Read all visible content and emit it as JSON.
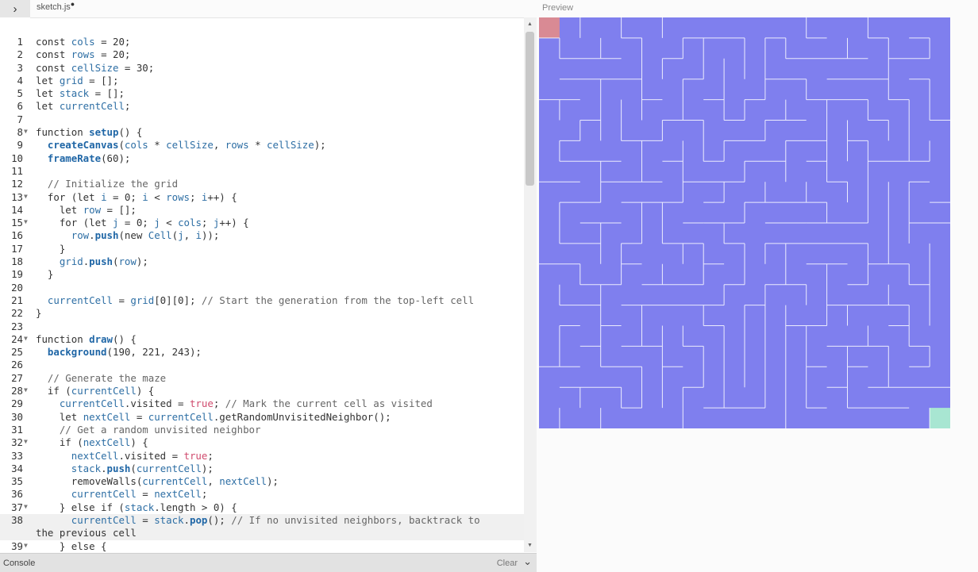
{
  "editor": {
    "toggle_icon": "chevron-right-icon",
    "filename": "sketch.js",
    "unsaved_dot": "●"
  },
  "preview": {
    "label": "Preview"
  },
  "console": {
    "label": "Console",
    "clear_label": "Clear"
  },
  "colors": {
    "maze_bg": "#7f7fee",
    "maze_walls": "#ffffff",
    "start_cell": "#d98a94",
    "end_cell": "#a8e6d2"
  },
  "maze": {
    "cols": 20,
    "rows": 20
  },
  "code_lines": [
    {
      "n": "1",
      "t": "const cols = 20;"
    },
    {
      "n": "2",
      "t": "const rows = 20;"
    },
    {
      "n": "3",
      "t": "const cellSize = 30;"
    },
    {
      "n": "4",
      "t": "let grid = [];"
    },
    {
      "n": "5",
      "t": "let stack = [];"
    },
    {
      "n": "6",
      "t": "let currentCell;"
    },
    {
      "n": "7",
      "t": ""
    },
    {
      "n": "8",
      "t": "function setup() {",
      "fold": true
    },
    {
      "n": "9",
      "t": "  createCanvas(cols * cellSize, rows * cellSize);"
    },
    {
      "n": "10",
      "t": "  frameRate(60);"
    },
    {
      "n": "11",
      "t": ""
    },
    {
      "n": "12",
      "t": "  // Initialize the grid"
    },
    {
      "n": "13",
      "t": "  for (let i = 0; i < rows; i++) {",
      "fold": true
    },
    {
      "n": "14",
      "t": "    let row = [];"
    },
    {
      "n": "15",
      "t": "    for (let j = 0; j < cols; j++) {",
      "fold": true
    },
    {
      "n": "16",
      "t": "      row.push(new Cell(j, i));"
    },
    {
      "n": "17",
      "t": "    }"
    },
    {
      "n": "18",
      "t": "    grid.push(row);"
    },
    {
      "n": "19",
      "t": "  }"
    },
    {
      "n": "20",
      "t": ""
    },
    {
      "n": "21",
      "t": "  currentCell = grid[0][0]; // Start the generation from the top-left cell"
    },
    {
      "n": "22",
      "t": "}"
    },
    {
      "n": "23",
      "t": ""
    },
    {
      "n": "24",
      "t": "function draw() {",
      "fold": true
    },
    {
      "n": "25",
      "t": "  background(190, 221, 243);"
    },
    {
      "n": "26",
      "t": ""
    },
    {
      "n": "27",
      "t": "  // Generate the maze"
    },
    {
      "n": "28",
      "t": "  if (currentCell) {",
      "fold": true
    },
    {
      "n": "29",
      "t": "    currentCell.visited = true; // Mark the current cell as visited"
    },
    {
      "n": "30",
      "t": "    let nextCell = currentCell.getRandomUnvisitedNeighbor();"
    },
    {
      "n": "31",
      "t": "    // Get a random unvisited neighbor"
    },
    {
      "n": "32",
      "t": "    if (nextCell) {",
      "fold": true
    },
    {
      "n": "33",
      "t": "      nextCell.visited = true;"
    },
    {
      "n": "34",
      "t": "      stack.push(currentCell);"
    },
    {
      "n": "35",
      "t": "      removeWalls(currentCell, nextCell);"
    },
    {
      "n": "36",
      "t": "      currentCell = nextCell;"
    },
    {
      "n": "37",
      "t": "    } else if (stack.length > 0) {",
      "fold": true
    },
    {
      "n": "38",
      "t": "      currentCell = stack.pop(); // If no unvisited neighbors, backtrack to",
      "wrap": "the previous cell",
      "active": true
    },
    {
      "n": "39",
      "t": "    } else {",
      "fold": true
    }
  ]
}
